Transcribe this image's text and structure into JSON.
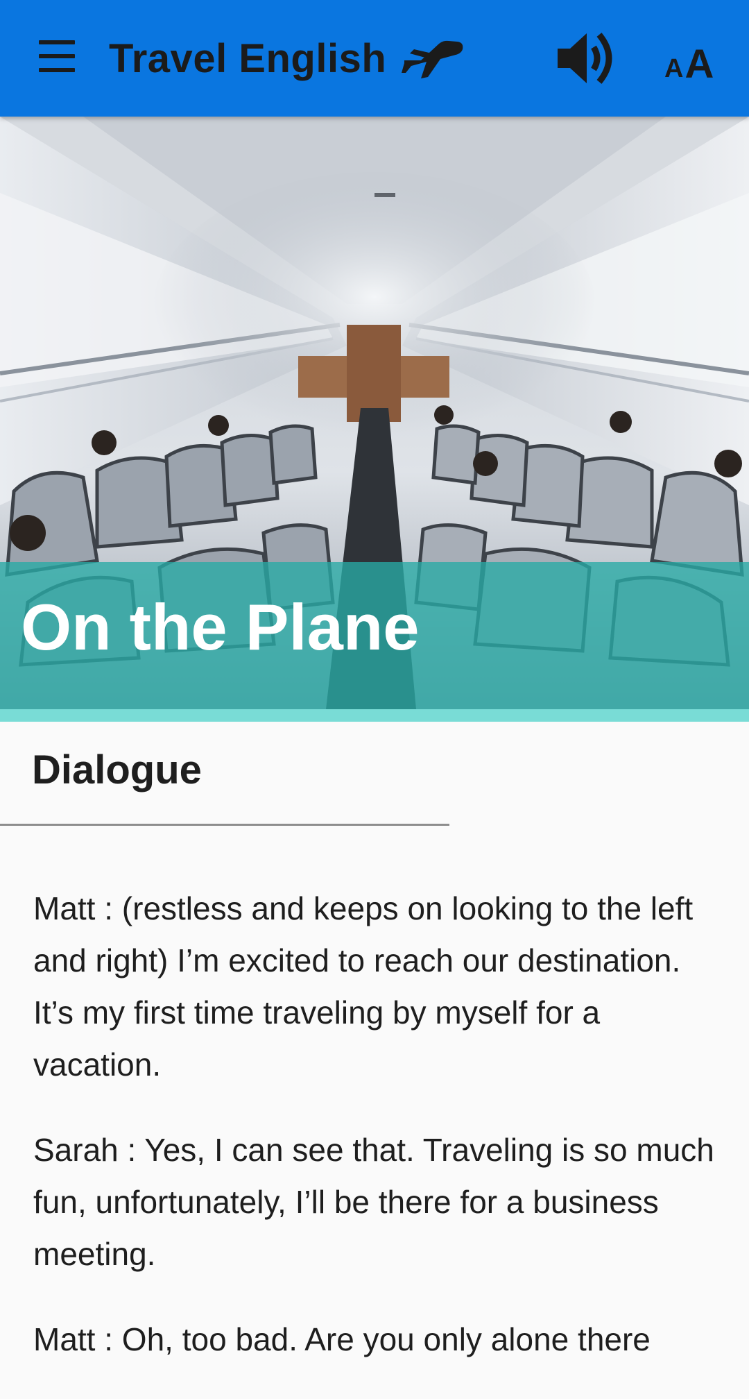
{
  "app_bar": {
    "title": "Travel English",
    "text_size_small": "A",
    "text_size_large": "A",
    "background_color": "#0a76e0",
    "icons": [
      "menu-icon",
      "airplane-icon",
      "volume-icon",
      "text-size-icon"
    ]
  },
  "lesson": {
    "title": "On the Plane",
    "band_color": "#28aaa5",
    "accent_color": "#79dcd6"
  },
  "section": {
    "heading": "Dialogue"
  },
  "dialogue": [
    {
      "text": "Matt : (restless and keeps on looking to the left and right) I’m excited to reach our destination. It’s my first time traveling by myself for a vacation."
    },
    {
      "text": "Sarah : Yes, I can see that. Traveling is so much fun, unfortunately, I’ll be there for a business meeting."
    },
    {
      "text": "Matt : Oh, too bad. Are you only alone there"
    }
  ]
}
